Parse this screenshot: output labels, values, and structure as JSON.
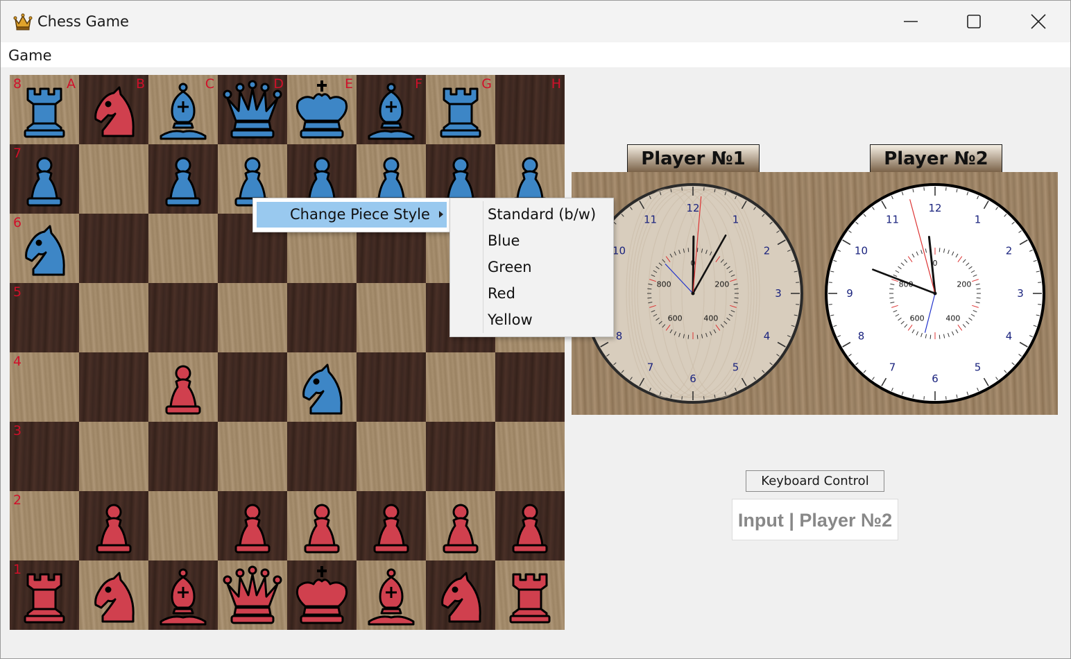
{
  "window": {
    "title": "Chess Game",
    "icon": "crown-icon",
    "controls": [
      "minimize-icon",
      "maximize-icon",
      "close-icon"
    ]
  },
  "menu": {
    "game_label": "Game"
  },
  "board": {
    "files": [
      "A",
      "B",
      "C",
      "D",
      "E",
      "F",
      "G",
      "H"
    ],
    "ranks": [
      "8",
      "7",
      "6",
      "5",
      "4",
      "3",
      "2",
      "1"
    ],
    "label_color": "#d0102a",
    "light_square_color": "#a48c6c",
    "dark_square_color": "#3a2620",
    "colors": {
      "blue": "#3d86c6",
      "red": "#d0404e"
    },
    "pieces": [
      {
        "square": "a8",
        "type": "rook",
        "color": "blue"
      },
      {
        "square": "b8",
        "type": "knight",
        "color": "red"
      },
      {
        "square": "c8",
        "type": "bishop",
        "color": "blue"
      },
      {
        "square": "d8",
        "type": "queen",
        "color": "blue"
      },
      {
        "square": "e8",
        "type": "king",
        "color": "blue"
      },
      {
        "square": "f8",
        "type": "bishop",
        "color": "blue"
      },
      {
        "square": "g8",
        "type": "rook",
        "color": "blue"
      },
      {
        "square": "a7",
        "type": "pawn",
        "color": "blue"
      },
      {
        "square": "c7",
        "type": "pawn",
        "color": "blue"
      },
      {
        "square": "d7",
        "type": "pawn",
        "color": "blue"
      },
      {
        "square": "e7",
        "type": "pawn",
        "color": "blue"
      },
      {
        "square": "f7",
        "type": "pawn",
        "color": "blue"
      },
      {
        "square": "g7",
        "type": "pawn",
        "color": "blue"
      },
      {
        "square": "h7",
        "type": "pawn",
        "color": "blue"
      },
      {
        "square": "a6",
        "type": "knight",
        "color": "blue"
      },
      {
        "square": "c4",
        "type": "pawn",
        "color": "red"
      },
      {
        "square": "e4",
        "type": "knight",
        "color": "blue"
      },
      {
        "square": "b2",
        "type": "pawn",
        "color": "red"
      },
      {
        "square": "d2",
        "type": "pawn",
        "color": "red"
      },
      {
        "square": "e2",
        "type": "pawn",
        "color": "red"
      },
      {
        "square": "f2",
        "type": "pawn",
        "color": "red"
      },
      {
        "square": "g2",
        "type": "pawn",
        "color": "red"
      },
      {
        "square": "h2",
        "type": "pawn",
        "color": "red"
      },
      {
        "square": "a1",
        "type": "rook",
        "color": "red"
      },
      {
        "square": "b1",
        "type": "knight",
        "color": "red"
      },
      {
        "square": "c1",
        "type": "bishop",
        "color": "red"
      },
      {
        "square": "d1",
        "type": "queen",
        "color": "red"
      },
      {
        "square": "e1",
        "type": "king",
        "color": "red"
      },
      {
        "square": "f1",
        "type": "bishop",
        "color": "red"
      },
      {
        "square": "g1",
        "type": "knight",
        "color": "red"
      },
      {
        "square": "h1",
        "type": "rook",
        "color": "red"
      }
    ]
  },
  "players": [
    {
      "label": "Player №1",
      "clock": {
        "hour_numbers": [
          "12",
          "1",
          "2",
          "3",
          "4",
          "5",
          "6",
          "7",
          "8",
          "9",
          "10",
          "11"
        ],
        "sub_dial_labels": [
          "0",
          "200",
          "400",
          "600",
          "800"
        ],
        "face_color": "#d8cdbd",
        "hand_hour": 0.98,
        "hand_minute": 0.1,
        "hand_second_red": 0.8,
        "hand_sub_blue": 0.88
      }
    },
    {
      "label": "Player №2",
      "clock": {
        "hour_numbers": [
          "12",
          "1",
          "2",
          "3",
          "4",
          "5",
          "6",
          "7",
          "8",
          "9",
          "10",
          "11"
        ],
        "sub_dial_labels": [
          "0",
          "200",
          "400",
          "600",
          "800"
        ],
        "face_color": "#ffffff",
        "hand_hour": 9.7,
        "hand_minute": 59.0,
        "hand_second_red": 57.5,
        "hand_sub_blue": 0.54
      }
    }
  ],
  "controls": {
    "keyboard_button": "Keyboard Control",
    "input_label": "Input | Player №2"
  },
  "context_menu": {
    "item": "Change Piece Style",
    "submenu": [
      "Standard (b/w)",
      "Blue",
      "Green",
      "Red",
      "Yellow"
    ]
  }
}
